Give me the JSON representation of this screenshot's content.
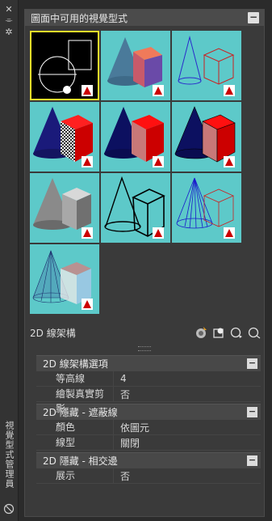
{
  "sidebar": {
    "close_glyph": "✕",
    "pin_glyph": "⌯",
    "settings_glyph": "✲",
    "title": "視覺型式管理員"
  },
  "gallery": {
    "title": "圖面中可用的視覺型式",
    "toggle": "−",
    "tiles": [
      {
        "name": "2d-wireframe",
        "selected": true
      },
      {
        "name": "conceptual"
      },
      {
        "name": "hidden"
      },
      {
        "name": "realistic-checker"
      },
      {
        "name": "shaded"
      },
      {
        "name": "shaded-edges"
      },
      {
        "name": "shades-of-gray"
      },
      {
        "name": "sketchy"
      },
      {
        "name": "wireframe"
      },
      {
        "name": "x-ray"
      }
    ],
    "current_style": "2D 線架構"
  },
  "properties": {
    "groups": [
      {
        "title": "2D 線架構選項",
        "toggle": "−",
        "rows": [
          {
            "key": "等高線",
            "value": "4"
          },
          {
            "key": "繪製真實剪影",
            "value": "否"
          }
        ]
      },
      {
        "title": "2D 隱藏 - 遮蔽線",
        "toggle": "−",
        "rows": [
          {
            "key": "顏色",
            "value": "依圖元"
          },
          {
            "key": "線型",
            "value": "關閉"
          }
        ]
      },
      {
        "title": "2D 隱藏 - 相交邊",
        "toggle": "−",
        "rows": [
          {
            "key": "展示",
            "value": "否"
          }
        ]
      }
    ]
  },
  "colors": {
    "tile_bg": "#5dc9c9",
    "selection": "#f2df2a",
    "cube_red": "#e01010",
    "cone_blue": "#1a2a8a"
  }
}
